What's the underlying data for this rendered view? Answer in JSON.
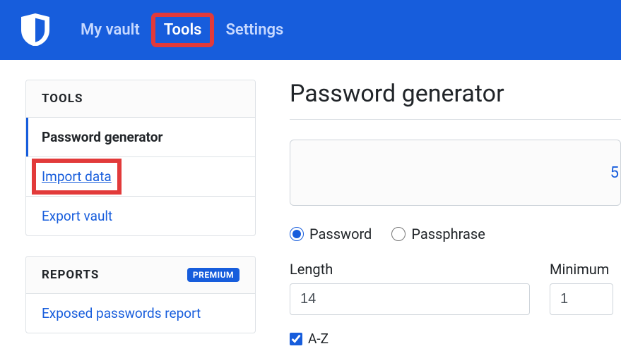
{
  "nav": {
    "items": [
      {
        "label": "My vault",
        "active": false
      },
      {
        "label": "Tools",
        "active": true
      },
      {
        "label": "Settings",
        "active": false
      }
    ]
  },
  "sidebar": {
    "section1": {
      "header": "TOOLS",
      "items": [
        {
          "label": "Password generator"
        },
        {
          "label": "Import data"
        },
        {
          "label": "Export vault"
        }
      ]
    },
    "section2": {
      "header": "REPORTS",
      "badge": "PREMIUM",
      "items": [
        {
          "label": "Exposed passwords report"
        }
      ]
    }
  },
  "main": {
    "title": "Password generator",
    "generated_fragment": "5",
    "type_password": "Password",
    "type_passphrase": "Passphrase",
    "length_label": "Length",
    "length_value": "14",
    "min_label": "Minimum",
    "min_value": "1",
    "check_az": "A-Z"
  }
}
